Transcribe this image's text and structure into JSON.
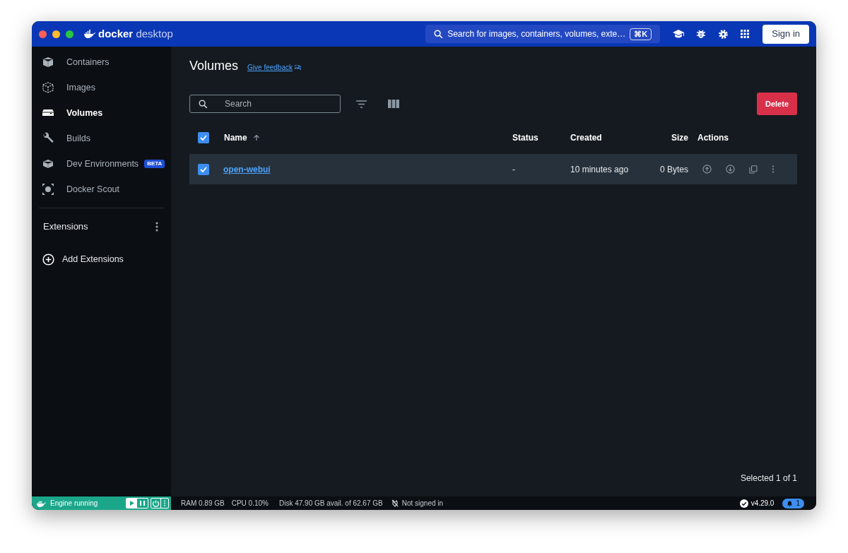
{
  "window": {
    "brand": "docker",
    "product": "desktop"
  },
  "topbar": {
    "search_placeholder": "Search for images, containers, volumes, exte…",
    "shortcut": "⌘K",
    "sign_in": "Sign in"
  },
  "sidebar": {
    "items": [
      {
        "kind": "containers",
        "label": "Containers",
        "selected": false
      },
      {
        "kind": "images",
        "label": "Images",
        "selected": false
      },
      {
        "kind": "volumes",
        "label": "Volumes",
        "selected": true
      },
      {
        "kind": "builds",
        "label": "Builds",
        "selected": false
      },
      {
        "kind": "dev",
        "label": "Dev Environments",
        "badge": "BETA",
        "selected": false
      },
      {
        "kind": "scout",
        "label": "Docker Scout",
        "selected": false
      }
    ],
    "extensions_heading": "Extensions",
    "add_extensions": "Add Extensions"
  },
  "page": {
    "title": "Volumes",
    "feedback": "Give feedback",
    "search_placeholder": "Search",
    "delete": "Delete"
  },
  "table": {
    "all_checked": true,
    "columns": [
      {
        "label": "Name",
        "sorted": true
      },
      {
        "label": "Status",
        "sorted": false
      },
      {
        "label": "Created",
        "sorted": false
      },
      {
        "label": "Size",
        "sorted": false
      },
      {
        "label": "Actions",
        "sorted": false
      }
    ],
    "rows": [
      {
        "selected": true,
        "name": "open-webui",
        "status": "-",
        "created": "10 minutes ago",
        "size": "0 Bytes"
      }
    ]
  },
  "footer": {
    "selection": "Selected 1 of 1"
  },
  "status_bar": {
    "engine": "Engine running",
    "ram": "RAM 0.89 GB",
    "cpu": "CPU 0.10%",
    "disk": "Disk 47.90 GB avail. of 62.67 GB",
    "account": "Not signed in",
    "version": "v4.29.0",
    "notifications": "1"
  }
}
